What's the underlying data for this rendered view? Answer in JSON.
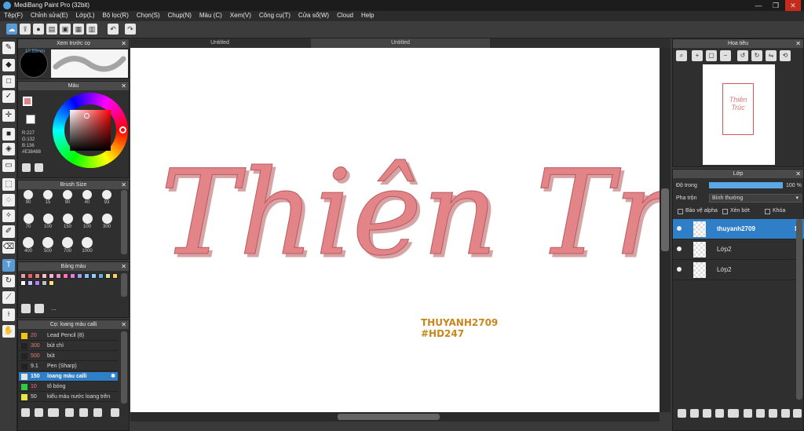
{
  "app": {
    "title": "MediBang Paint Pro (32bit)"
  },
  "window_controls": {
    "minimize": "—",
    "maximize": "❐",
    "close": "✕"
  },
  "menu": [
    "Tệp(F)",
    "Chỉnh sửa(E)",
    "Lớp(L)",
    "Bộ lọc(R)",
    "Chọn(S)",
    "Chụp(N)",
    "Màu (C)",
    "Xem(V)",
    "Công cụ(T)",
    "Cửa sổ(W)",
    "Cloud",
    "Help"
  ],
  "toolbar": {
    "icons": [
      "cloud-icon",
      "export-icon",
      "speech-icon",
      "doc-icon",
      "save-icon",
      "grid-icon",
      "table-icon",
      "undo-icon",
      "redo-icon"
    ]
  },
  "left_tools": [
    "brush-icon",
    "eraser-icon",
    "rect-icon",
    "pen-icon",
    "move-icon",
    "fill-rect-icon",
    "bucket-icon",
    "gradient-icon",
    "select-icon",
    "lasso-icon",
    "wand-icon",
    "select-pen-icon",
    "select-eraser-icon",
    "text-icon",
    "operation-icon",
    "dropper-icon",
    "eyedropper-icon",
    "hand-icon"
  ],
  "brush_preview": {
    "title": "Xem trước cọ",
    "size": "10.89mm"
  },
  "color_panel": {
    "title": "Màu",
    "r": "R:227",
    "g": "G:132",
    "b": "B:136",
    "hex": "#E38488",
    "fg_color": "#E38488"
  },
  "brush_size": {
    "title": "Brush Size",
    "sizes": [
      "90",
      "15",
      "90",
      "40",
      "93",
      "70",
      "100",
      "150",
      "100",
      "300",
      "400",
      "500",
      "700",
      "1000"
    ]
  },
  "palette": {
    "title": "Bảng màu",
    "more": "...",
    "colors": [
      "#e8a0a0",
      "#e86060",
      "#f08080",
      "#ffc0c0",
      "#ffb0d0",
      "#f090c0",
      "#ff70b0",
      "#e080e0",
      "#a0a0f0",
      "#80c0ff",
      "#90d0ff",
      "#60b0e0",
      "#e0e0a0",
      "#ffd060",
      "#ffffff",
      "#c0c0ff",
      "#b080ff",
      "#c0c0c0",
      "#ffe070"
    ]
  },
  "brush_list": {
    "title": "Cọ: loang màu calli",
    "items": [
      {
        "size": "20",
        "name": "Lead Pencil (8)",
        "color": "#f1c40f"
      },
      {
        "size": "300",
        "name": "bút chì",
        "color": "#222"
      },
      {
        "size": "500",
        "name": "bút",
        "color": "#222"
      },
      {
        "size": "9.1",
        "name": "Pen (Sharp)",
        "color": "#222"
      },
      {
        "size": "150",
        "name": "loang màu calli",
        "color": "#e6e6e6"
      },
      {
        "size": "10",
        "name": "tô bóng",
        "color": "#2ecc40"
      },
      {
        "size": "50",
        "name": "kiểu màu nước loang trên",
        "color": "#e8e840"
      }
    ]
  },
  "tabs": [
    "Untitled",
    "Untitled"
  ],
  "canvas": {
    "calligraphy": "Thiên Trúc",
    "signature_line1": "THUYANH2709",
    "signature_line2": "#HD247"
  },
  "navigator": {
    "title": "Hoa tiêu",
    "thumb_text": "Thiên Trúc"
  },
  "layers": {
    "title": "Lớp",
    "opacity_label": "Độ trong",
    "opacity_value": "100 %",
    "blend_label": "Pha trộn",
    "blend_value": "Bình thường",
    "protect_alpha": "Bảo vệ alpha",
    "clipping": "Xén bớt",
    "lock": "Khóa",
    "items": [
      {
        "name": "thuyanh2709",
        "selected": true
      },
      {
        "name": "Lớp2",
        "selected": false
      },
      {
        "name": "Lớp2",
        "selected": false
      }
    ]
  }
}
